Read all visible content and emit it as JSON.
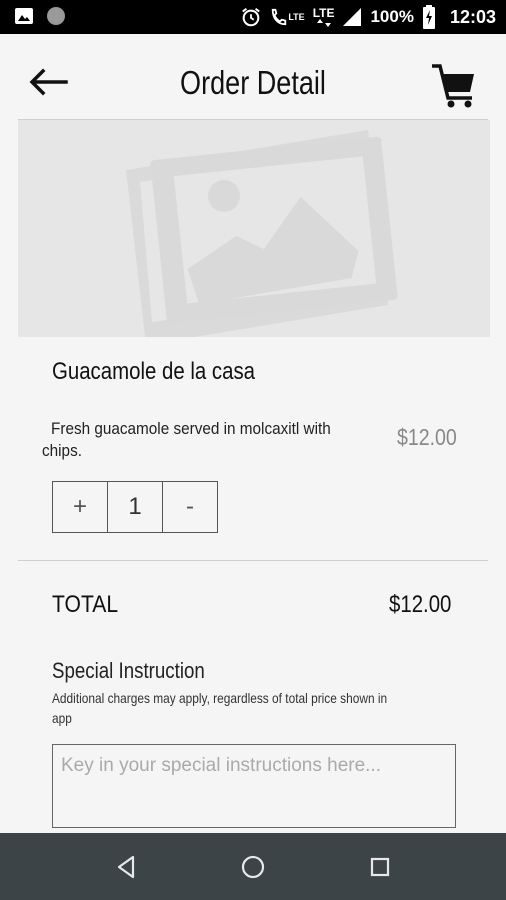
{
  "status_bar": {
    "battery": "100%",
    "time": "12:03",
    "network_1": "LTE",
    "network_2": "LTE"
  },
  "header": {
    "title": "Order Detail"
  },
  "item": {
    "name": "Guacamole de la casa",
    "description": "Fresh guacamole served in molcaxitl with chips.",
    "price": "$12.00",
    "quantity": "1",
    "increment_label": "+",
    "decrement_label": "-"
  },
  "total": {
    "label": "TOTAL",
    "value": "$12.00"
  },
  "special_instruction": {
    "title": "Special Instruction",
    "note": "Additional charges may apply, regardless of total price shown in app",
    "placeholder": "Key in your special instructions here...",
    "value": ""
  },
  "colors": {
    "status_bar": "#000000",
    "background": "#f5f5f5",
    "image_placeholder": "#e6e6e6",
    "nav_bar": "#3c4447",
    "price_gray": "#888888"
  }
}
